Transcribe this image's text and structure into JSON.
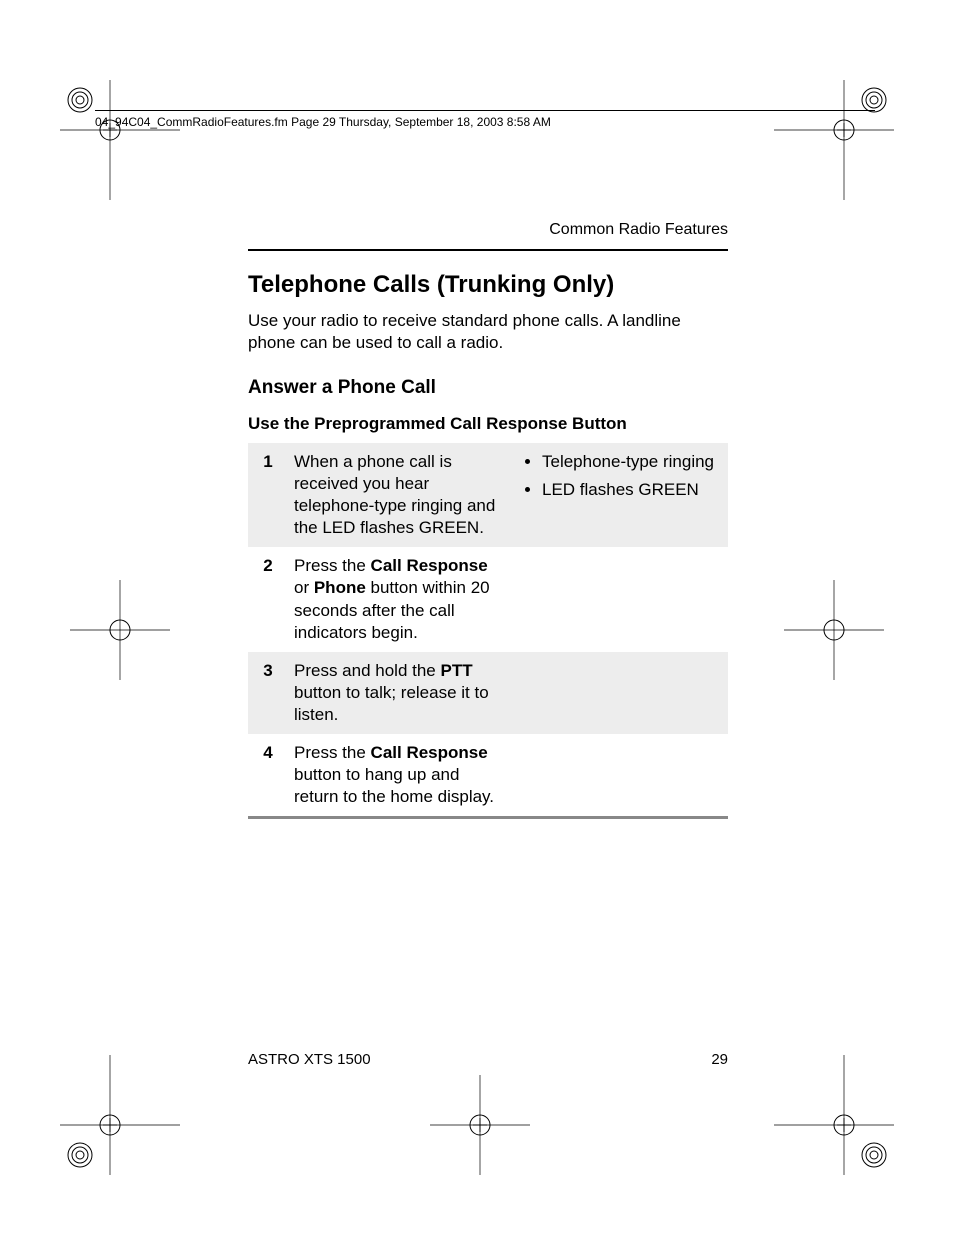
{
  "meta_header": "04_94C04_CommRadioFeatures.fm  Page 29  Thursday, September 18, 2003  8:58 AM",
  "running_head": "Common Radio Features",
  "title": "Telephone Calls (Trunking Only)",
  "intro": "Use your radio to receive standard phone calls. A landline phone can be used to call a radio.",
  "section": "Answer a Phone Call",
  "subsection": "Use the Preprogrammed Call Response Button",
  "steps": [
    {
      "num": "1",
      "desc": "When a phone call is received you hear telephone-type ringing and the LED flashes GREEN.",
      "indicators": [
        "Telephone-type ringing",
        "LED flashes GREEN"
      ]
    },
    {
      "num": "2",
      "desc_parts": [
        "Press the ",
        "Call Response",
        " or ",
        "Phone",
        " button within 20 seconds after the call indicators begin."
      ]
    },
    {
      "num": "3",
      "desc_parts": [
        "Press and hold the ",
        "PTT",
        " button to talk; release it to listen."
      ]
    },
    {
      "num": "4",
      "desc_parts": [
        "Press the ",
        "Call Response",
        " button to hang up and return to the home display."
      ]
    }
  ],
  "footer_left": "ASTRO XTS 1500",
  "footer_right": "29"
}
